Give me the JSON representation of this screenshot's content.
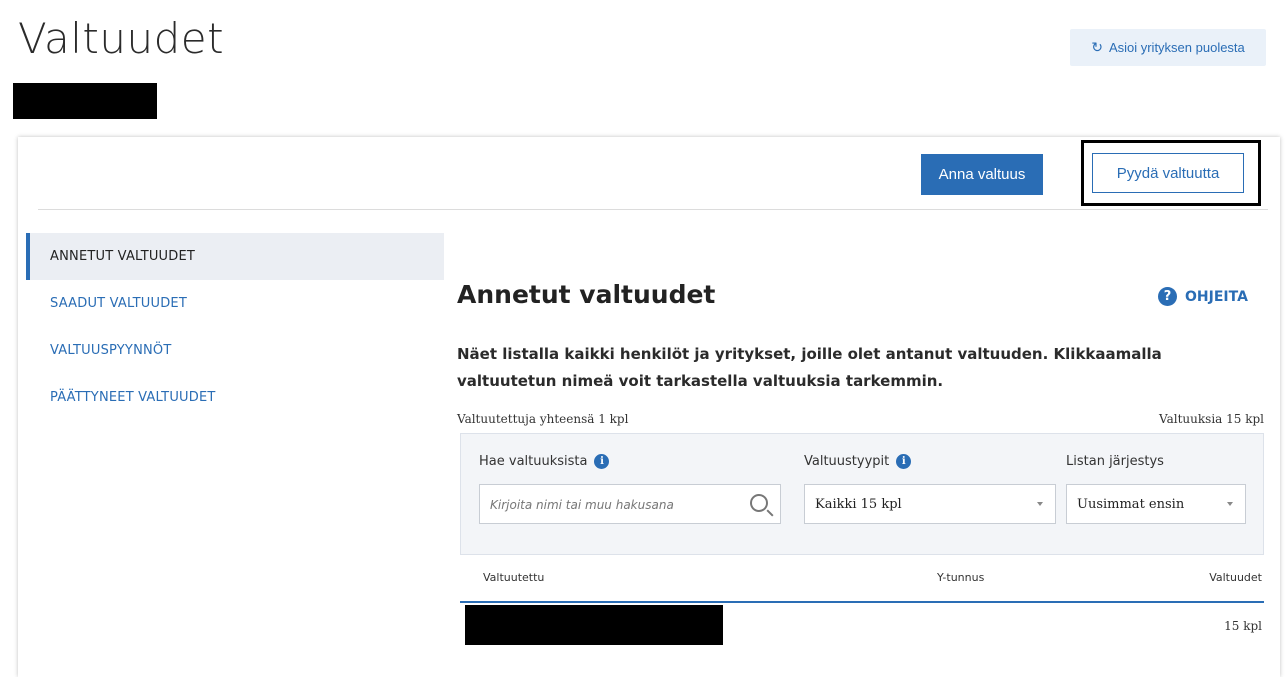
{
  "page": {
    "title": "Valtuudet"
  },
  "header": {
    "act_on_behalf_label": "Asioi yrityksen puolesta",
    "act_on_behalf_icon": "refresh-icon"
  },
  "toolbar": {
    "give_label": "Anna valtuus",
    "request_label": "Pyydä valtuutta"
  },
  "sidebar": {
    "items": [
      {
        "label": "ANNETUT VALTUUDET",
        "active": true
      },
      {
        "label": "SAADUT VALTUUDET",
        "active": false
      },
      {
        "label": "VALTUUSPYYNNÖT",
        "active": false
      },
      {
        "label": "PÄÄTTYNEET VALTUUDET",
        "active": false
      }
    ]
  },
  "main": {
    "title": "Annetut valtuudet",
    "help_label": "OHJEITA",
    "description": "Näet listalla kaikki henkilöt ja yritykset, joille olet antanut valtuuden. Klikkaamalla valtuutetun nimeä voit tarkastella valtuuksia tarkemmin.",
    "count_left": "Valtuutettuja yhteensä 1 kpl",
    "count_right": "Valtuuksia 15 kpl"
  },
  "filters": {
    "search_label": "Hae valtuuksista",
    "search_placeholder": "Kirjoita nimi tai muu hakusana",
    "type_label": "Valtuustyypit",
    "type_value": "Kaikki 15 kpl",
    "order_label": "Listan järjestys",
    "order_value": "Uusimmat ensin"
  },
  "table": {
    "columns": [
      "Valtuutettu",
      "Y-tunnus",
      "Valtuudet"
    ],
    "rows": [
      {
        "valtuudet": "15 kpl"
      }
    ]
  },
  "colors": {
    "accent": "#2a6db5",
    "active_nav_bg": "#ebeef3",
    "filter_bg": "#f3f5f8"
  }
}
